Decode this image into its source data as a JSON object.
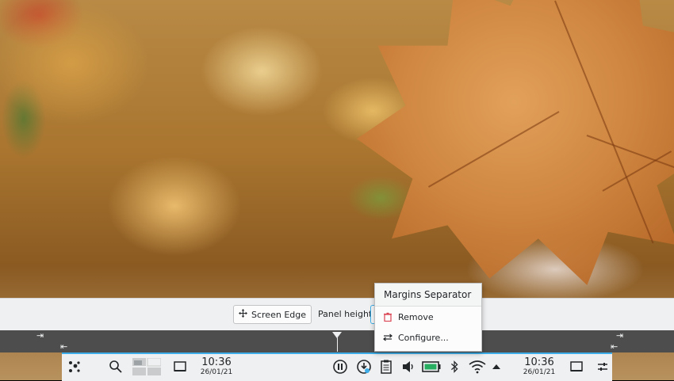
{
  "config": {
    "screen_edge_label": "Screen Edge",
    "panel_height_label": "Panel height:"
  },
  "context_menu": {
    "title": "Margins Separator",
    "items": [
      {
        "label": "Remove",
        "icon": "trash-icon"
      },
      {
        "label": "Configure...",
        "icon": "configure-icon"
      }
    ]
  },
  "panel": {
    "clock_left": {
      "time": "10:36",
      "date": "26/01/21"
    },
    "clock_right": {
      "time": "10:36",
      "date": "26/01/21"
    },
    "icons": [
      "application-launcher-icon",
      "search-icon",
      "pager-icon",
      "show-desktop-icon",
      "media-pause-icon",
      "updates-icon",
      "clipboard-icon",
      "volume-icon",
      "battery-icon",
      "bluetooth-icon",
      "wifi-icon",
      "expand-tray-icon",
      "show-desktop-icon",
      "panel-settings-icon"
    ]
  },
  "colors": {
    "accent": "#3daee9",
    "panel_bg": "#eff0f1",
    "ruler_bg": "#4d4d4d",
    "remove_icon": "#da4453"
  }
}
